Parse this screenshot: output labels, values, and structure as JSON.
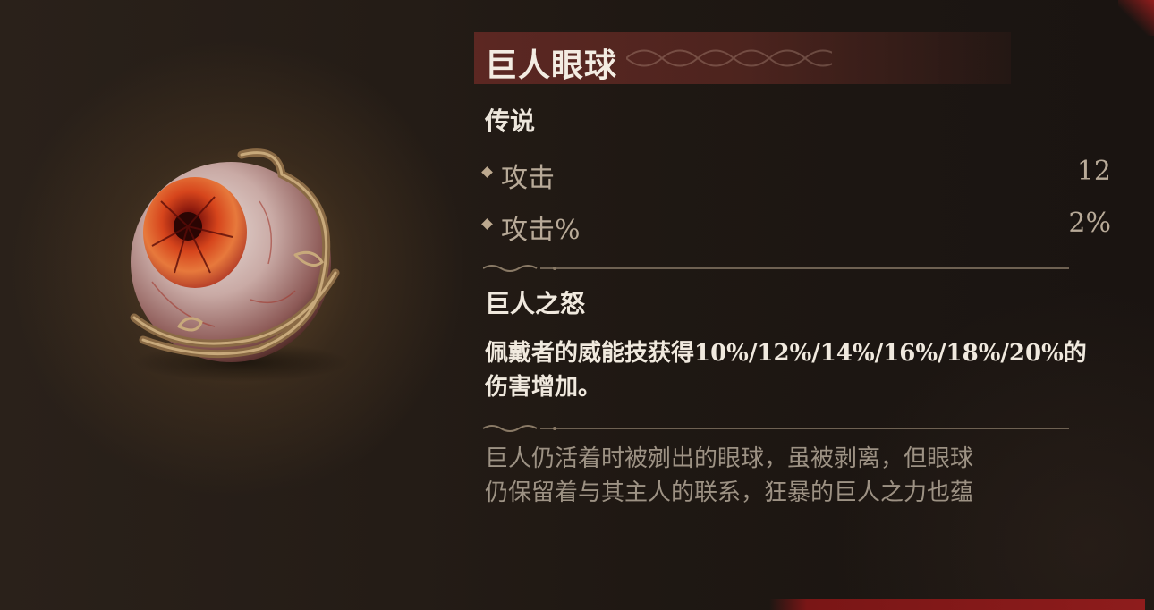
{
  "item": {
    "name": "巨人眼球",
    "rarity": "传说",
    "icon": "giant-eyeball-icon"
  },
  "stats": [
    {
      "label": "攻击",
      "value": "12"
    },
    {
      "label": "攻击%",
      "value": "2%"
    }
  ],
  "skill": {
    "name": "巨人之怒",
    "description_line1": "佩戴者的威能技获得10%/12%/14%/16%/18%/20%的",
    "description_line2": "伤害增加。"
  },
  "lore": {
    "line1": "巨人仍活着时被剜出的眼球，虽被剥离，但眼球",
    "line2": "仍保留着与其主人的联系，狂暴的巨人之力也蕴"
  },
  "colors": {
    "title_bar": "#5f2823",
    "title_text": "#f3ece2",
    "stat_text": "#b8aa98",
    "lore_text": "#9d9284",
    "accent_red": "#8e1c1c"
  }
}
